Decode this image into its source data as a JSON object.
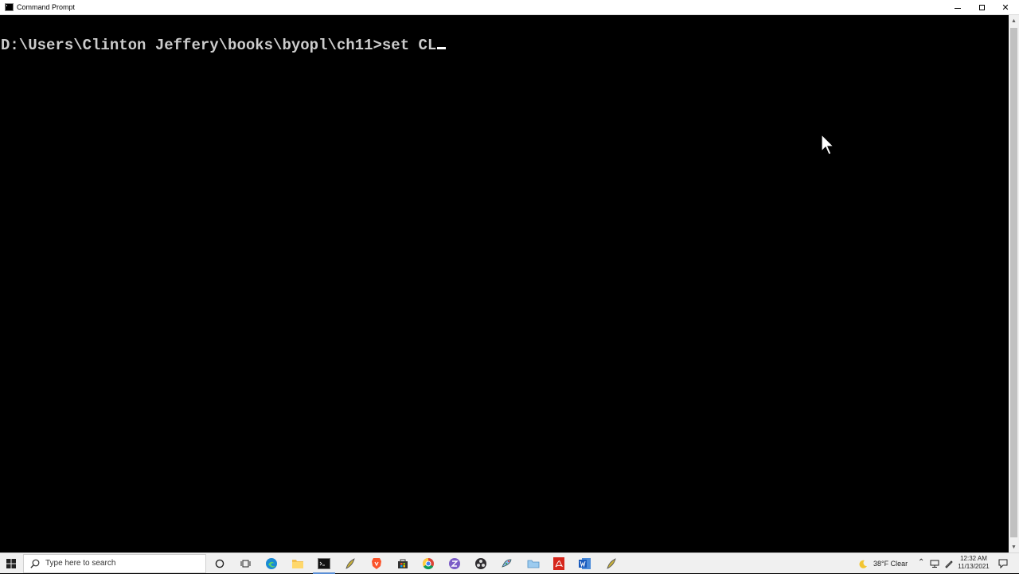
{
  "window": {
    "title": "Command Prompt",
    "controls": {
      "minimize": "minimize",
      "maximize": "maximize",
      "close": "✕"
    }
  },
  "console": {
    "prompt": "D:\\Users\\Clinton Jeffery\\books\\byopl\\ch11>",
    "typed_command": "set CL"
  },
  "taskbar": {
    "search_placeholder": "Type here to search",
    "pinned_icons": [
      "cortana-icon",
      "task-view-icon",
      "edge-icon",
      "file-explorer-icon",
      "command-prompt-icon",
      "unicon-icon",
      "brave-icon",
      "store-icon",
      "chrome-icon",
      "zotero-icon",
      "obs-icon",
      "paint-icon",
      "folder-icon",
      "acrobat-icon",
      "word-icon",
      "unicon-icon"
    ],
    "weather": "38°F  Clear",
    "clock_time": "12:32 AM",
    "clock_date": "11/13/2021"
  },
  "colors": {
    "console_bg": "#000000",
    "console_text": "#cccccc",
    "taskbar_bg": "#f0f0f0"
  }
}
